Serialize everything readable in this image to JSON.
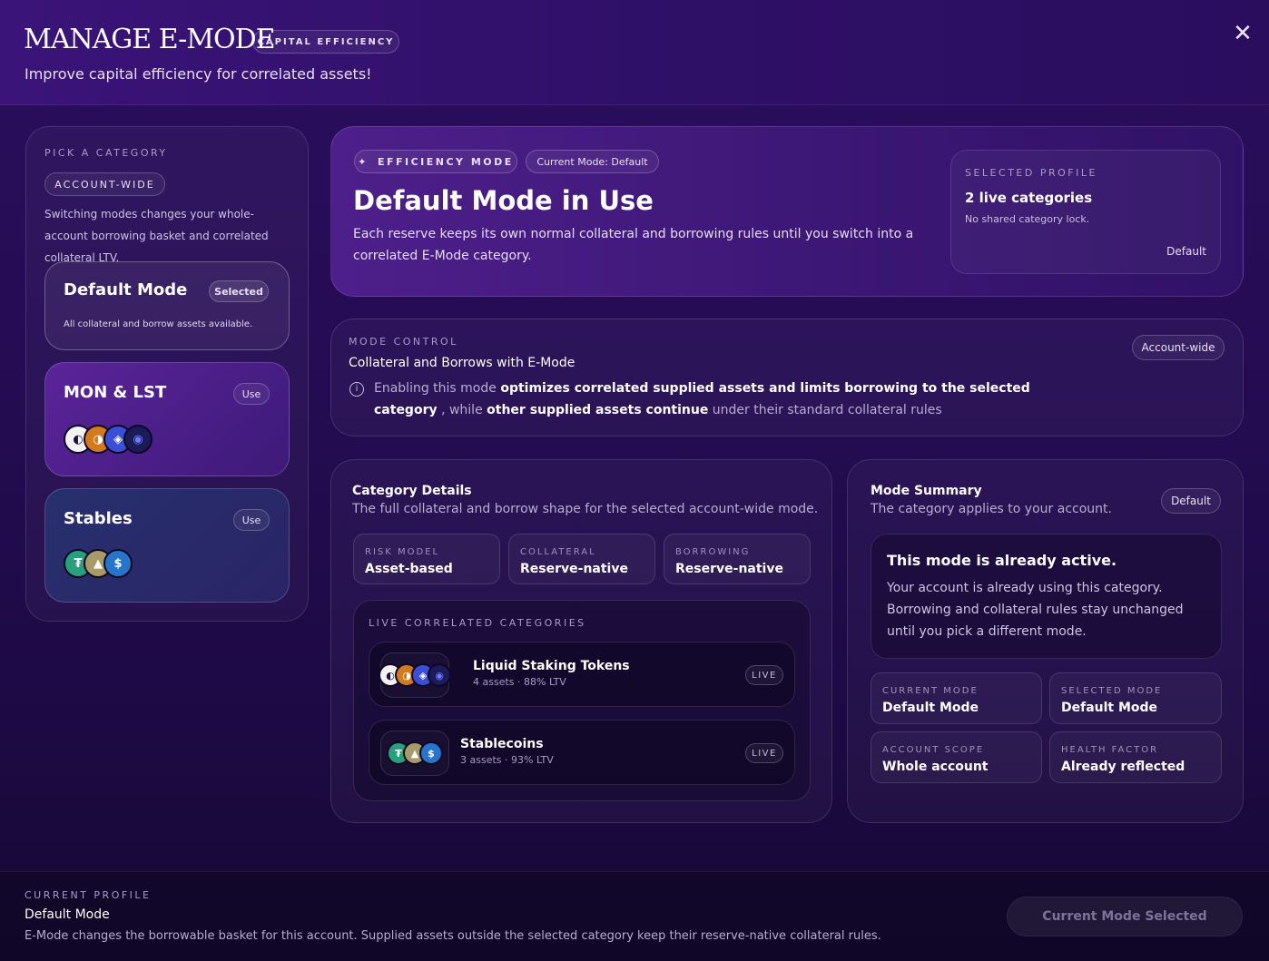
{
  "header": {
    "title": "Manage E-Mode",
    "badge": "CAPITAL EFFICIENCY",
    "subtitle": "Improve capital efficiency for correlated assets!",
    "close_icon": "close-icon"
  },
  "sidebar": {
    "eyebrow": "PICK A CATEGORY",
    "scope_pill": "ACCOUNT-WIDE",
    "description": "Switching modes changes your whole-account borrowing basket and correlated collateral LTV.",
    "categories": [
      {
        "title": "Default Mode",
        "badge": "Selected",
        "description": "All collateral and borrow assets available."
      },
      {
        "title": "MON & LST",
        "badge": "Use"
      },
      {
        "title": "Stables",
        "badge": "Use"
      }
    ]
  },
  "hero": {
    "eyebrow_pill": "EFFICIENCY MODE",
    "current_mode_pill": "Current Mode: Default",
    "title": "Default Mode in Use",
    "description": "Each reserve keeps its own normal collateral and borrowing rules until you switch into a correlated E-Mode category.",
    "profile": {
      "eyebrow": "SELECTED PROFILE",
      "value": "2 live categories",
      "note": "No shared category lock.",
      "tag": "Default"
    }
  },
  "mode_control": {
    "eyebrow": "MODE CONTROL",
    "title": "Collateral and Borrows with E-Mode",
    "scope": "Account-wide",
    "text_1": "Enabling this mode",
    "text_2": "optimizes correlated supplied assets and limits borrowing to the selected category",
    "text_3": ", while",
    "text_4": "other supplied assets continue",
    "text_5": "under their standard collateral rules"
  },
  "category_details": {
    "title": "Category Details",
    "subtitle": "The full collateral and borrow shape for the selected account-wide mode.",
    "tiles": [
      {
        "label": "RISK MODEL",
        "value": "Asset-based"
      },
      {
        "label": "COLLATERAL",
        "value": "Reserve-native"
      },
      {
        "label": "BORROWING",
        "value": "Reserve-native"
      }
    ],
    "live_eyebrow": "LIVE CORRELATED CATEGORIES",
    "live": [
      {
        "name": "Liquid Staking Tokens",
        "meta": "4 assets · 88% LTV",
        "status": "LIVE"
      },
      {
        "name": "Stablecoins",
        "meta": "3 assets · 93% LTV",
        "status": "LIVE"
      }
    ]
  },
  "mode_summary": {
    "title": "Mode Summary",
    "subtitle": "The category applies to your account.",
    "tag": "Default",
    "notice_title": "This mode is already active.",
    "notice_body": "Your account is already using this category. Borrowing and collateral rules stay unchanged until you pick a different mode.",
    "tiles": [
      {
        "label": "CURRENT MODE",
        "value": "Default Mode"
      },
      {
        "label": "SELECTED MODE",
        "value": "Default Mode"
      },
      {
        "label": "ACCOUNT SCOPE",
        "value": "Whole account"
      },
      {
        "label": "HEALTH FACTOR",
        "value": "Already reflected"
      }
    ]
  },
  "footer": {
    "eyebrow": "CURRENT PROFILE",
    "value": "Default Mode",
    "note": "E-Mode changes the borrowable basket for this account. Supplied assets outside the selected category keep their reserve-native collateral rules.",
    "cta": "Current Mode Selected"
  }
}
